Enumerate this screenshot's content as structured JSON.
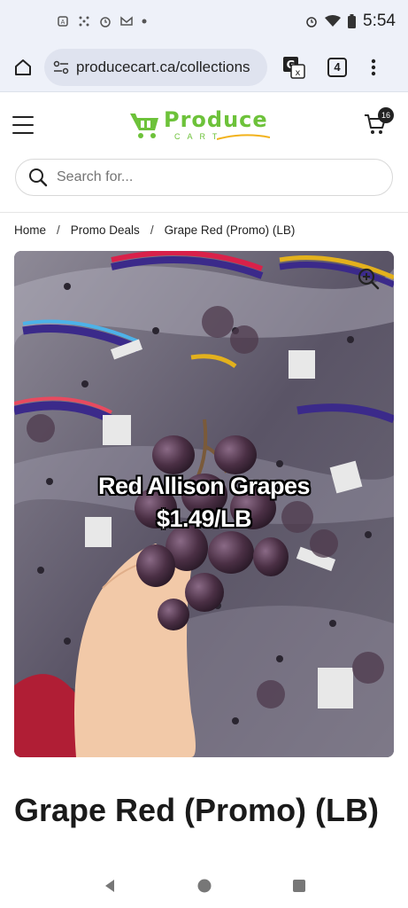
{
  "status_bar": {
    "time": "5:54",
    "left_icons": [
      "notification-icon",
      "dots-icon",
      "alarm-icon",
      "gmail-icon",
      "dot-icon"
    ],
    "right_icons": [
      "alarm-icon",
      "wifi-icon",
      "battery-icon"
    ]
  },
  "browser": {
    "url": "producecart.ca/collections",
    "tab_count": "4"
  },
  "site": {
    "logo_word": "Produce",
    "logo_sub": "CART",
    "cart_count": "16"
  },
  "search": {
    "placeholder": "Search for..."
  },
  "breadcrumb": {
    "items": [
      "Home",
      "Promo Deals",
      "Grape Red (Promo) (LB)"
    ],
    "separator": "/"
  },
  "product": {
    "image_overlay_line1": "Red Allison Grapes",
    "image_overlay_line2": "$1.49/LB",
    "title": "Grape Red (Promo) (LB)"
  },
  "colors": {
    "brand_green": "#6dc23a",
    "browser_bg": "#eef1f9"
  }
}
